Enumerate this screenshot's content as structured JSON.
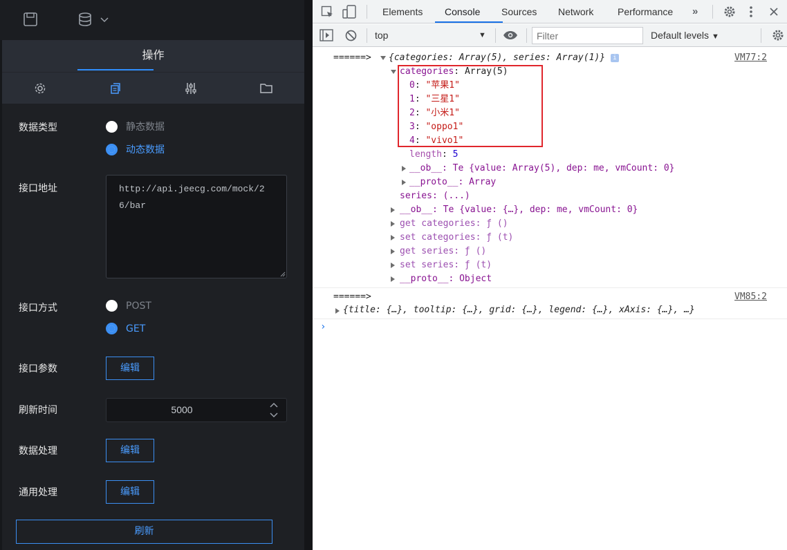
{
  "left_panel": {
    "panel_title": "操作",
    "form": {
      "data_type": {
        "label": "数据类型",
        "options": [
          "静态数据",
          "动态数据"
        ],
        "selected": "动态数据"
      },
      "api_url": {
        "label": "接口地址",
        "value": "http://api.jeecg.com/mock/26/bar"
      },
      "api_method": {
        "label": "接口方式",
        "options": [
          "POST",
          "GET"
        ],
        "selected": "GET"
      },
      "api_params": {
        "label": "接口参数",
        "button": "编辑"
      },
      "refresh_interval": {
        "label": "刷新时间",
        "value": "5000"
      },
      "data_processing": {
        "label": "数据处理",
        "button": "编辑"
      },
      "general_processing": {
        "label": "通用处理",
        "button": "编辑"
      },
      "refresh_button": "刷新"
    },
    "colors": {
      "accent": "#3c8ff3",
      "background": "#1e2024"
    }
  },
  "devtools": {
    "tabs": [
      "Elements",
      "Console",
      "Sources",
      "Network",
      "Performance"
    ],
    "active_tab": "Console",
    "context": "top",
    "filter_placeholder": "Filter",
    "levels": "Default levels",
    "console": {
      "entry1": {
        "prefix": "======>",
        "summary": "{categories: Array(5), series: Array(1)}",
        "source": "VM77:2",
        "categories_key": "categories",
        "categories_type": "Array(5)",
        "items": [
          {
            "index": "0",
            "value": "\"苹果1\""
          },
          {
            "index": "1",
            "value": "\"三星1\""
          },
          {
            "index": "2",
            "value": "\"小米1\""
          },
          {
            "index": "3",
            "value": "\"oppo1\""
          },
          {
            "index": "4",
            "value": "\"vivo1\""
          }
        ],
        "length_key": "length",
        "length_value": "5",
        "ob_line": "__ob__: Te {value: Array(5), dep: me, vmCount: 0}",
        "proto_line": "__proto__: Array",
        "series_line": "series: (...)",
        "ob2_line": "__ob__: Te {value: {…}, dep: me, vmCount: 0}",
        "get_categories": "get categories: ƒ ()",
        "set_categories": "set categories: ƒ (t)",
        "get_series": "get series: ƒ ()",
        "set_series": "set series: ƒ (t)",
        "proto2_line": "__proto__: Object"
      },
      "entry2": {
        "prefix": "======>",
        "summary": "{title: {…}, tooltip: {…}, grid: {…}, legend: {…}, xAxis: {…}, …}",
        "source": "VM85:2"
      },
      "prompt": "›"
    },
    "colors": {
      "active_underline": "#1a73e8",
      "highlight_box": "#e0262c"
    }
  }
}
